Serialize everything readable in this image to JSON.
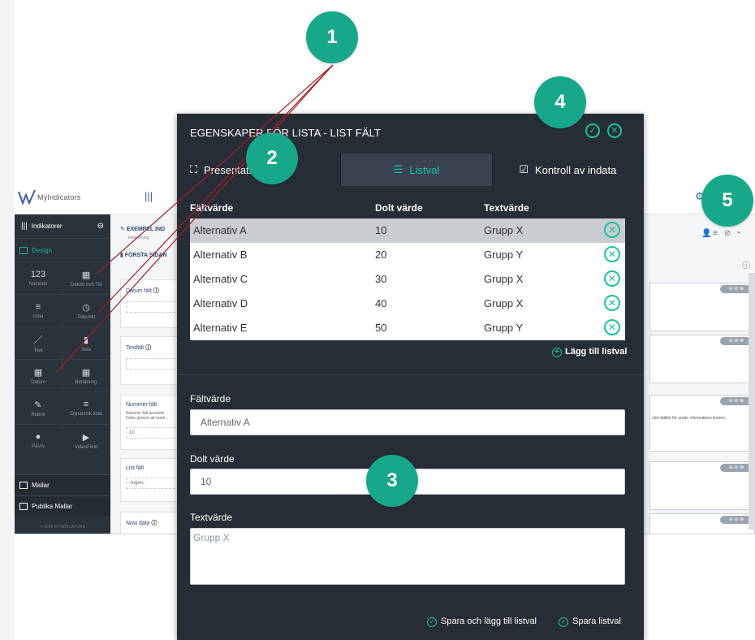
{
  "app": {
    "logo_text": "MyIndicators",
    "header": {
      "title_fragment": "EXEMPEL IND",
      "subtitle_fragment": "beskrivning",
      "page_fragment": "FÖRSTA SIDAN"
    },
    "sidebar": {
      "indicators": "Indikatorer",
      "design": "Design",
      "items": [
        {
          "glyph": "123",
          "label": "Nummer"
        },
        {
          "glyph": "▦",
          "label": "Datum och Tid"
        },
        {
          "glyph": "≡",
          "label": "Lista"
        },
        {
          "glyph": "◷",
          "label": "Tidpunkt"
        },
        {
          "glyph": "／",
          "label": "Text"
        },
        {
          "glyph": "▮",
          "label": "Sida"
        },
        {
          "glyph": "▦",
          "label": "Datum"
        },
        {
          "glyph": "▦",
          "label": "Beräkning"
        },
        {
          "glyph": "✎",
          "label": "Rubrik"
        },
        {
          "glyph": "≡",
          "label": "Dynamisk lista"
        },
        {
          "glyph": "●",
          "label": "På/Av"
        },
        {
          "glyph": "▶",
          "label": "VideoField"
        }
      ],
      "templates": "Mallar",
      "public_templates": "Publika Mallar",
      "copyright": "© 2016 MYINDICATORS"
    },
    "fields": [
      {
        "label": "Datum fält",
        "value": ""
      },
      {
        "label": "Textfält",
        "value": ""
      },
      {
        "label": "Nummer fält",
        "value": "10",
        "help": "Nummer fält används ... Detta genom att mark..."
      },
      {
        "label": "List fält",
        "value": "-Ingen-"
      },
      {
        "label": "Now data",
        "value": ""
      }
    ],
    "right_hint": "...ttet istället för under informations ikonen.",
    "pill_text": "⊖ ⊘ ⊗"
  },
  "modal": {
    "title": "EGENSKAPER FÖR LISTA - LIST FÄLT",
    "tabs": [
      {
        "label": "Presentation"
      },
      {
        "label": "Listval"
      },
      {
        "label": "Kontroll av indata"
      }
    ],
    "table": {
      "headers": {
        "field": "Fältvärde",
        "hidden": "Dolt värde",
        "text": "Textvärde"
      },
      "rows": [
        {
          "field": "Alternativ A",
          "hidden": "10",
          "text": "Grupp X"
        },
        {
          "field": "Alternativ B",
          "hidden": "20",
          "text": "Grupp Y"
        },
        {
          "field": "Alternativ C",
          "hidden": "30",
          "text": "Grupp X"
        },
        {
          "field": "Alternativ D",
          "hidden": "40",
          "text": "Grupp X"
        },
        {
          "field": "Alternativ E",
          "hidden": "50",
          "text": "Grupp Y"
        }
      ]
    },
    "add_label": "Lägg till listval",
    "form": {
      "field_label": "Fältvärde",
      "field_value": "Alternativ A",
      "hidden_label": "Dolt värde",
      "hidden_value": "10",
      "text_label": "Textvärde",
      "text_value": "Grupp X"
    },
    "footer": {
      "save_add": "Spara och lägg till listval",
      "save": "Spara listval"
    }
  },
  "callouts": [
    "1",
    "2",
    "3",
    "4",
    "5"
  ],
  "colors": {
    "accent": "#19c3a0",
    "badge": "#17a88a",
    "modal_bg": "#262d36",
    "sidebar_bg": "#2a323c"
  }
}
